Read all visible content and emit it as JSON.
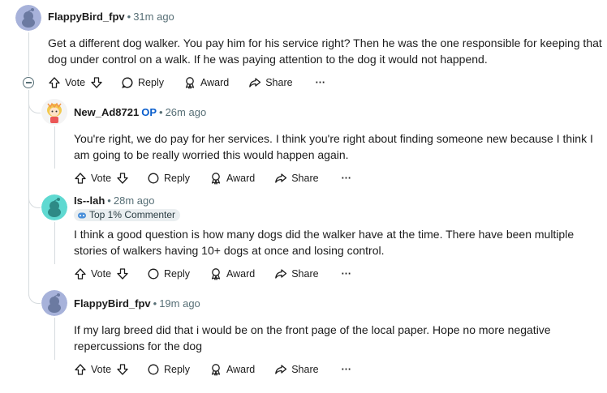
{
  "colors": {
    "op": "#0a5ecc",
    "meta": "#576f76",
    "thread_line": "#d6dbde"
  },
  "actions": {
    "vote": "Vote",
    "reply": "Reply",
    "award": "Award",
    "share": "Share",
    "more": "···"
  },
  "comments": [
    {
      "author": "FlappyBird_fpv",
      "time": "31m ago",
      "text": "Get a different dog walker. You pay him for his service right? Then he was the one responsible for keeping that dog under control on a walk. If he was paying attention to the dog it would not happend."
    },
    {
      "author": "New_Ad8721",
      "op_label": "OP",
      "time": "26m ago",
      "text": "You're right, we do pay for her services. I think you're right about finding someone new because I think I am going to be really worried this would happen again."
    },
    {
      "author": "Is--lah",
      "time": "28m ago",
      "badge": "Top 1% Commenter",
      "text": "I think a good question is how many dogs did the walker have at the time. There have been multiple stories of walkers having 10+ dogs at once and losing control."
    },
    {
      "author": "FlappyBird_fpv",
      "time": "19m ago",
      "text": "If my larg breed did that i would be on the front page of the local paper. Hope no more negative repercussions for the dog"
    }
  ]
}
